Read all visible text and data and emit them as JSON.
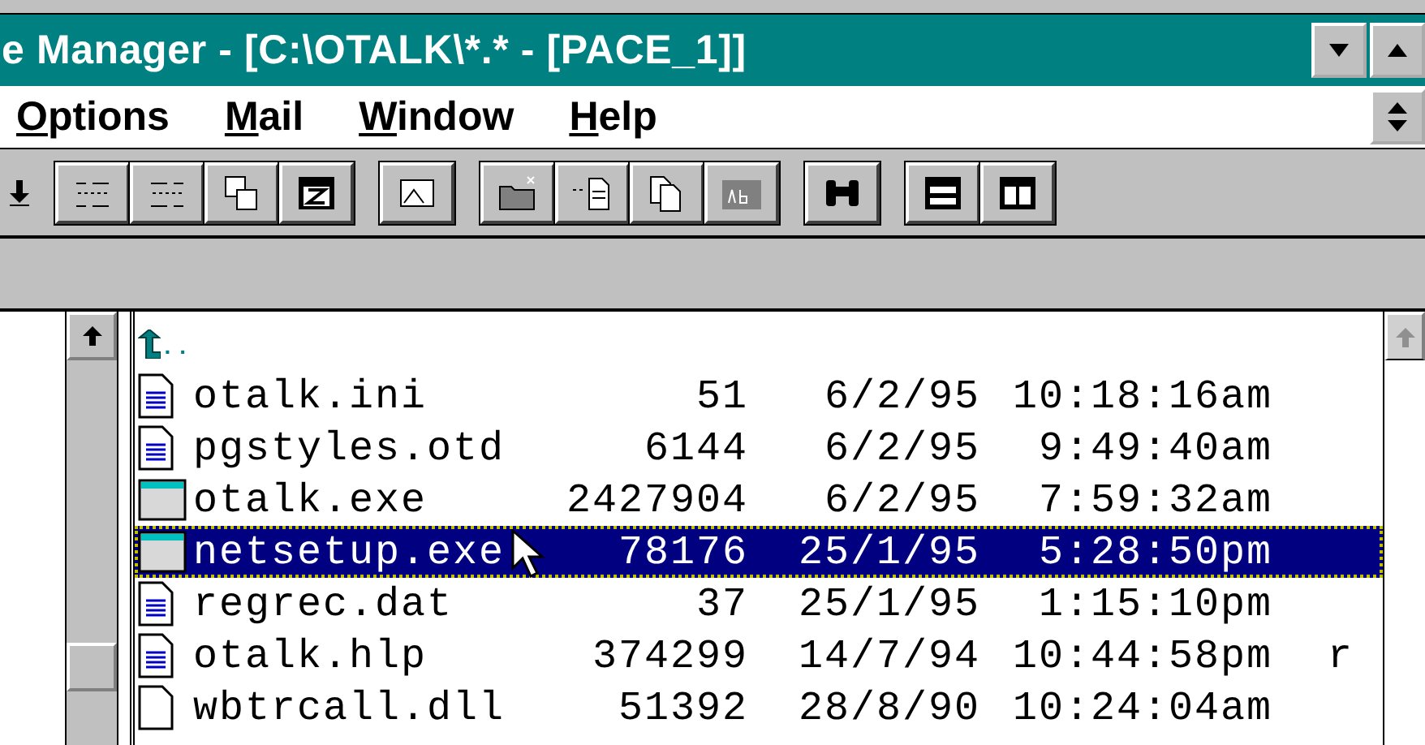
{
  "window": {
    "title": "e Manager - [C:\\OTALK\\*.* - [PACE_1]]"
  },
  "menu": [
    {
      "accel": "O",
      "rest": "ptions"
    },
    {
      "accel": "M",
      "rest": "ail"
    },
    {
      "accel": "W",
      "rest": "indow"
    },
    {
      "accel": "H",
      "rest": "elp"
    }
  ],
  "parent_dir": {
    "label": ".."
  },
  "files": [
    {
      "kind": "document",
      "name": "otalk.ini",
      "size": "51",
      "date": "6/2/95",
      "time": "10:18:16am",
      "selected": false
    },
    {
      "kind": "document",
      "name": "pgstyles.otd",
      "size": "6144",
      "date": "6/2/95",
      "time": "9:49:40am",
      "selected": false
    },
    {
      "kind": "program",
      "name": "otalk.exe",
      "size": "2427904",
      "date": "6/2/95",
      "time": "7:59:32am",
      "selected": false
    },
    {
      "kind": "program",
      "name": "netsetup.exe",
      "size": "78176",
      "date": "25/1/95",
      "time": "5:28:50pm",
      "selected": true
    },
    {
      "kind": "document",
      "name": "regrec.dat",
      "size": "37",
      "date": "25/1/95",
      "time": "1:15:10pm",
      "selected": false
    },
    {
      "kind": "document",
      "name": "otalk.hlp",
      "size": "374299",
      "date": "14/7/94",
      "time": "10:44:58pm",
      "attributes": "r",
      "selected": false
    },
    {
      "kind": "blank",
      "name": "wbtrcall.dll",
      "size": "51392",
      "date": "28/8/90",
      "time": "10:24:04am",
      "selected": false
    }
  ]
}
